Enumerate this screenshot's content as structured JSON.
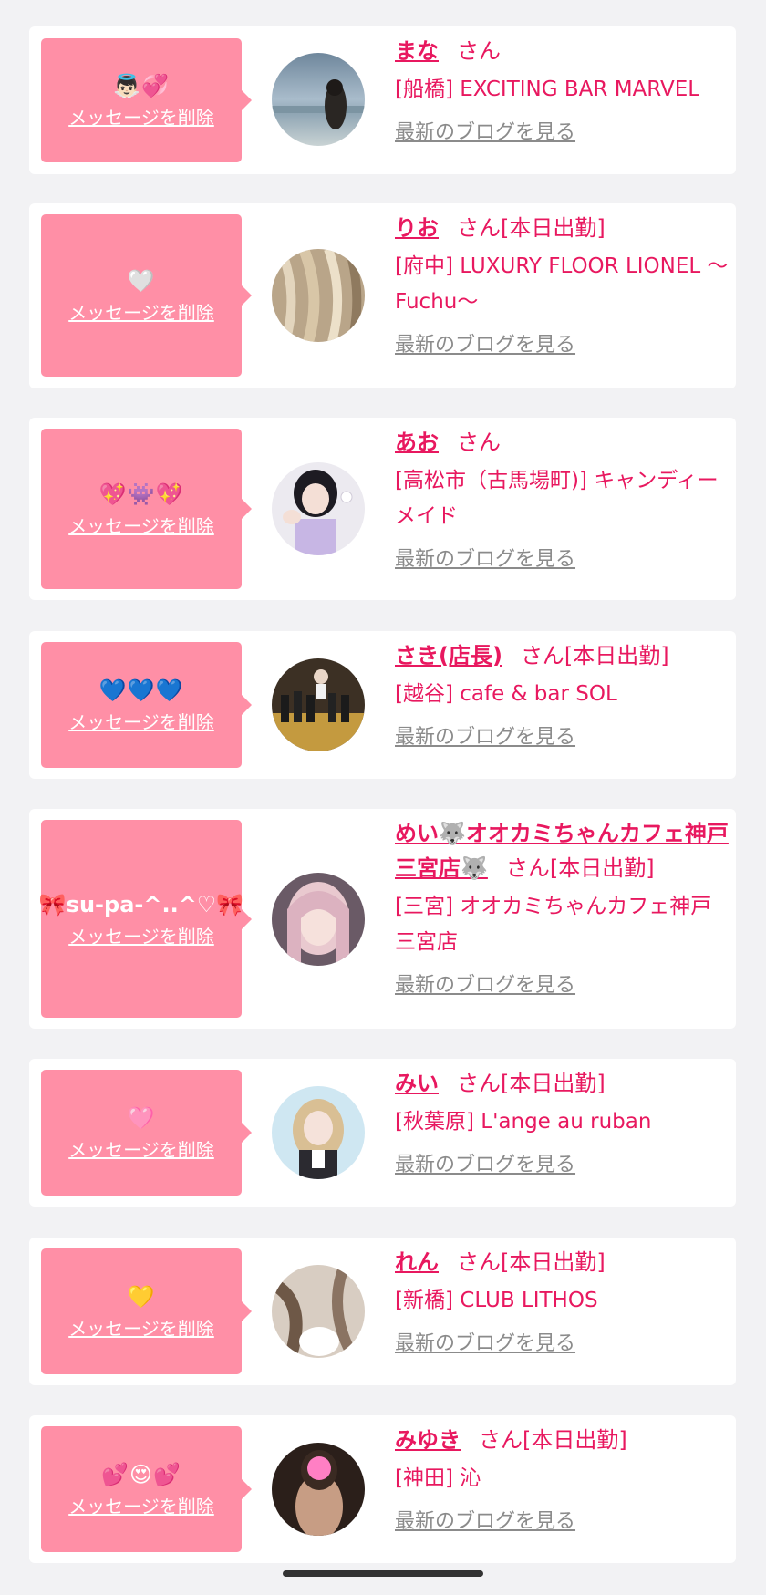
{
  "delete_label": "メッセージを削除",
  "blog_label": "最新のブログを見る",
  "colors": {
    "accent": "#e8185f",
    "message_box": "#ff8fa6",
    "card": "#ffffff",
    "background": "#f2f2f4",
    "blog_link": "#8b8b8b"
  },
  "items": [
    {
      "message": "👼🏻💞",
      "name": "まな",
      "suffix": "さん",
      "shop": "[船橋] EXCITING BAR MARVEL",
      "avatar_icon": "beach-photo-avatar"
    },
    {
      "message": "🤍",
      "name": "りお",
      "suffix": "さん[本日出勤]",
      "shop": "[府中] LUXURY FLOOR LIONEL 〜Fuchu〜",
      "avatar_icon": "hair-photo-avatar"
    },
    {
      "message": "💖👾💖",
      "name": "あお",
      "suffix": "さん",
      "shop": "[高松市（古馬場町)] キャンディーメイド",
      "avatar_icon": "maid-photo-avatar"
    },
    {
      "message": "💙💙💙",
      "name": "さき(店長)",
      "suffix": "さん[本日出勤]",
      "shop": "[越谷] cafe & bar SOL",
      "avatar_icon": "bottles-photo-avatar"
    },
    {
      "message": "🎀su-pa-^..^♡🎀",
      "name": "めい🐺オオカミちゃんカフェ神戸三宮店🐺",
      "suffix": "さん[本日出勤]",
      "shop": "[三宮] オオカミちゃんカフェ神戸三宮店",
      "avatar_icon": "portrait-photo-avatar"
    },
    {
      "message": "🩷",
      "name": "みい",
      "suffix": "さん[本日出勤]",
      "shop": "[秋葉原] L'ange au ruban",
      "avatar_icon": "portrait-photo-avatar"
    },
    {
      "message": "💛",
      "name": "れん",
      "suffix": "さん[本日出勤]",
      "shop": "[新橋] CLUB LITHOS",
      "avatar_icon": "hair-photo-avatar"
    },
    {
      "message": "💕😍💕",
      "name": "みゆき",
      "suffix": "さん[本日出勤]",
      "shop": "[神田] 沁",
      "avatar_icon": "portrait-photo-avatar"
    }
  ]
}
